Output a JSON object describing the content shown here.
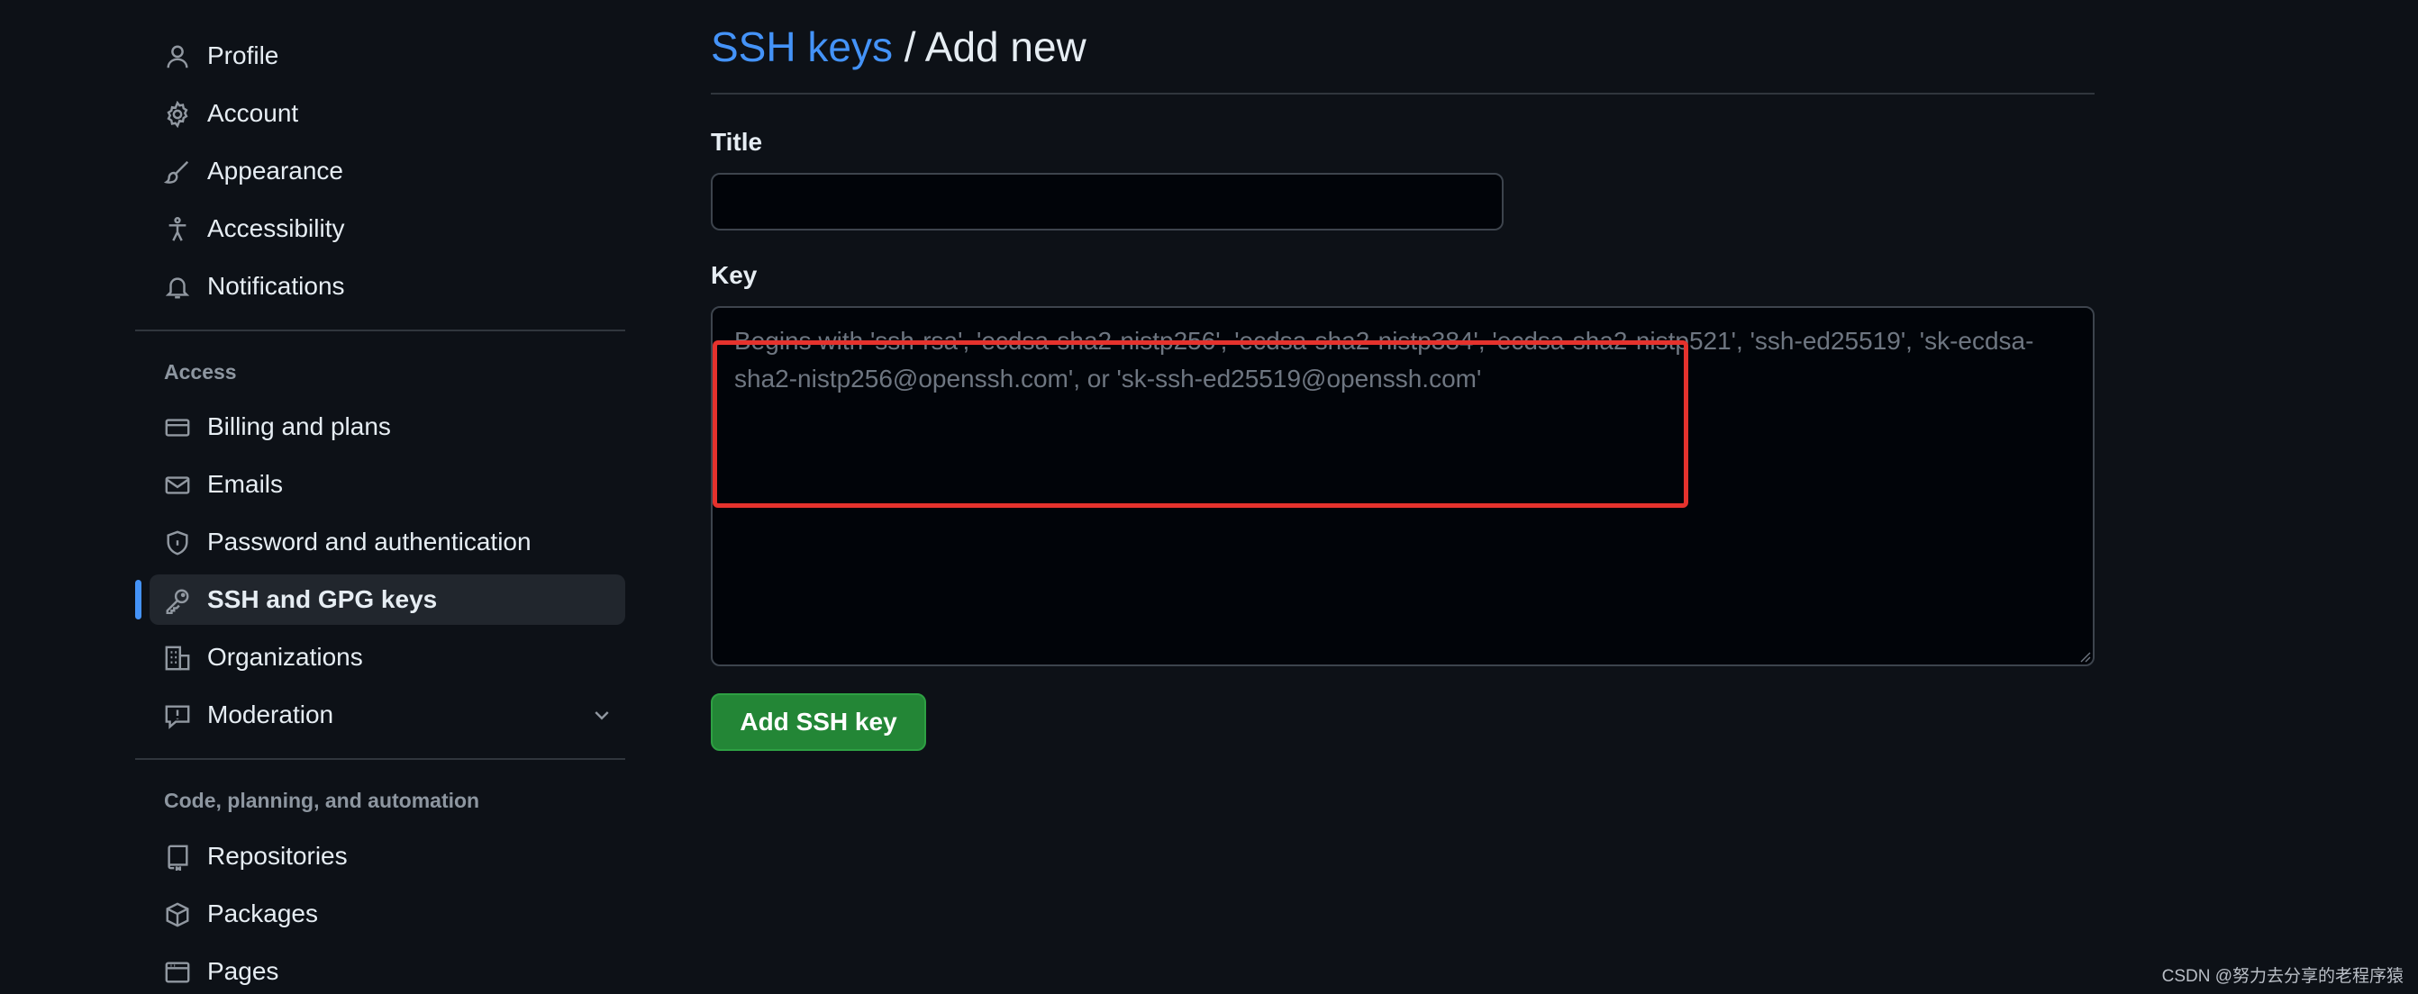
{
  "sidebar": {
    "top_items": [
      {
        "label": "Profile",
        "icon": "person-icon"
      },
      {
        "label": "Account",
        "icon": "gear-icon"
      },
      {
        "label": "Appearance",
        "icon": "paintbrush-icon"
      },
      {
        "label": "Accessibility",
        "icon": "accessibility-icon"
      },
      {
        "label": "Notifications",
        "icon": "bell-icon"
      }
    ],
    "access_heading": "Access",
    "access_items": [
      {
        "label": "Billing and plans",
        "icon": "credit-card-icon"
      },
      {
        "label": "Emails",
        "icon": "mail-icon"
      },
      {
        "label": "Password and authentication",
        "icon": "shield-lock-icon"
      },
      {
        "label": "SSH and GPG keys",
        "icon": "key-icon",
        "active": true
      },
      {
        "label": "Organizations",
        "icon": "organization-icon"
      },
      {
        "label": "Moderation",
        "icon": "report-icon",
        "expandable": true
      }
    ],
    "code_heading": "Code, planning, and automation",
    "code_items": [
      {
        "label": "Repositories",
        "icon": "repo-icon"
      },
      {
        "label": "Packages",
        "icon": "package-icon"
      },
      {
        "label": "Pages",
        "icon": "browser-icon"
      }
    ]
  },
  "header": {
    "breadcrumb_link": "SSH keys",
    "separator": "/",
    "current": "Add new"
  },
  "form": {
    "title_label": "Title",
    "title_value": "",
    "key_label": "Key",
    "key_value": "",
    "key_placeholder": "Begins with 'ssh-rsa', 'ecdsa-sha2-nistp256', 'ecdsa-sha2-nistp384', 'ecdsa-sha2-nistp521', 'ssh-ed25519', 'sk-ecdsa-sha2-nistp256@openssh.com', or 'sk-ssh-ed25519@openssh.com'",
    "submit_label": "Add SSH key"
  },
  "watermark": "CSDN @努力去分享的老程序猿",
  "colors": {
    "background": "#0d1117",
    "link": "#4493f8",
    "button": "#238636",
    "highlight": "#e5322d",
    "active_marker": "#4493f8"
  }
}
